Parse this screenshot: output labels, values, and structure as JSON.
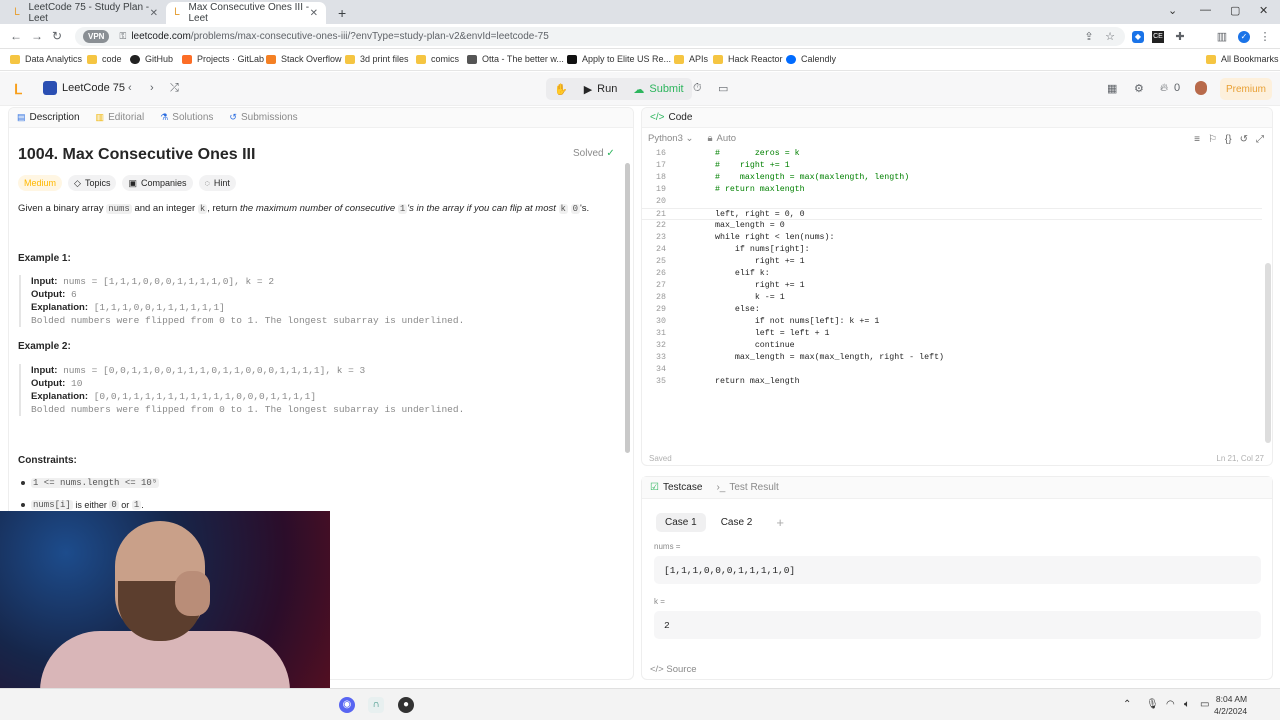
{
  "browser": {
    "tabs": [
      {
        "label": "LeetCode 75 - Study Plan - Leet"
      },
      {
        "label": "Max Consecutive Ones III - Leet"
      }
    ],
    "new_tab": "+",
    "vpn": "VPN",
    "url_host": "leetcode.com",
    "url_path": "/problems/max-consecutive-ones-iii/?envType=study-plan-v2&envId=leetcode-75",
    "bookmarks": [
      "Data Analytics",
      "code",
      "GitHub",
      "Projects · GitLab",
      "Stack Overflow",
      "3d print files",
      "comics",
      "Otta - The better w...",
      "Apply to Elite US Re...",
      "APIs",
      "Hack Reactor",
      "Calendly"
    ],
    "all_bookmarks": "All Bookmarks"
  },
  "header": {
    "study_plan": "LeetCode 75",
    "run": "Run",
    "submit": "Submit",
    "premium": "Premium",
    "streak": "0"
  },
  "left": {
    "tabs": [
      "Description",
      "Editorial",
      "Solutions",
      "Submissions"
    ],
    "title": "1004. Max Consecutive Ones III",
    "solved": "Solved",
    "tags": [
      "Medium",
      "Topics",
      "Companies",
      "Hint"
    ],
    "desc": {
      "p1": "Given a binary array",
      "c1": "nums",
      "p2": "and an integer",
      "c2": "k",
      "p3": ", return",
      "p4": "the maximum number of consecutive",
      "c3": "1",
      "p5": "'s in the array if you can flip at most",
      "c4": "k",
      "c5": "0",
      "p6": "'s."
    },
    "ex1": {
      "title": "Example 1:",
      "input_label": "Input:",
      "input": "nums = [1,1,1,0,0,0,1,1,1,1,0], k = 2",
      "output_label": "Output:",
      "output": "6",
      "expl_label": "Explanation:",
      "expl": "[1,1,1,0,0,1,1,1,1,1,1]",
      "note": "Bolded numbers were flipped from 0 to 1. The longest subarray is underlined."
    },
    "ex2": {
      "title": "Example 2:",
      "input_label": "Input:",
      "input": "nums = [0,0,1,1,0,0,1,1,1,0,1,1,0,0,0,1,1,1,1], k = 3",
      "output_label": "Output:",
      "output": "10",
      "expl_label": "Explanation:",
      "expl": "[0,0,1,1,1,1,1,1,1,1,1,1,0,0,0,1,1,1,1]",
      "note": "Bolded numbers were flipped from 0 to 1. The longest subarray is underlined."
    },
    "constraints_title": "Constraints:",
    "c1": "1 <= nums.length <= 10⁵",
    "c2a": "nums[i]",
    "c2b": "is either",
    "c2c": "0",
    "c2d": "or",
    "c2e": "1",
    "c2f": "."
  },
  "editor": {
    "tab": "Code",
    "lang": "Python3",
    "auto": "Auto",
    "saved": "Saved",
    "cursor": "Ln 21, Col 27",
    "lines": [
      {
        "n": "16",
        "t": "        #       zeros = k",
        "c": "cm"
      },
      {
        "n": "17",
        "t": "        #    right += 1",
        "c": "cm"
      },
      {
        "n": "18",
        "t": "        #    maxlength = max(maxlength, length)",
        "c": "cm"
      },
      {
        "n": "19",
        "t": "        # return maxlength",
        "c": "cm"
      },
      {
        "n": "20",
        "t": "",
        "c": ""
      },
      {
        "n": "21",
        "t": "        left, right = 0, 0",
        "c": ""
      },
      {
        "n": "22",
        "t": "        max_length = 0",
        "c": ""
      },
      {
        "n": "23",
        "t": "        while right < len(nums):",
        "c": ""
      },
      {
        "n": "24",
        "t": "            if nums[right]:",
        "c": ""
      },
      {
        "n": "25",
        "t": "                right += 1",
        "c": ""
      },
      {
        "n": "26",
        "t": "            elif k:",
        "c": ""
      },
      {
        "n": "27",
        "t": "                right += 1",
        "c": ""
      },
      {
        "n": "28",
        "t": "                k -= 1",
        "c": ""
      },
      {
        "n": "29",
        "t": "            else:",
        "c": ""
      },
      {
        "n": "30",
        "t": "                if not nums[left]: k += 1",
        "c": ""
      },
      {
        "n": "31",
        "t": "                left = left + 1",
        "c": ""
      },
      {
        "n": "32",
        "t": "                continue",
        "c": ""
      },
      {
        "n": "33",
        "t": "            max_length = max(max_length, right - left)",
        "c": ""
      },
      {
        "n": "34",
        "t": "",
        "c": ""
      },
      {
        "n": "35",
        "t": "        return max_length",
        "c": ""
      }
    ]
  },
  "tests": {
    "tab1": "Testcase",
    "tab2": "Test Result",
    "case1": "Case 1",
    "case2": "Case 2",
    "add": "+",
    "nums_label": "nums =",
    "nums": "[1,1,1,0,0,0,1,1,1,1,0]",
    "k_label": "k =",
    "k": "2",
    "source": "Source"
  },
  "taskbar": {
    "time": "8:04 AM",
    "date": "4/2/2024"
  }
}
